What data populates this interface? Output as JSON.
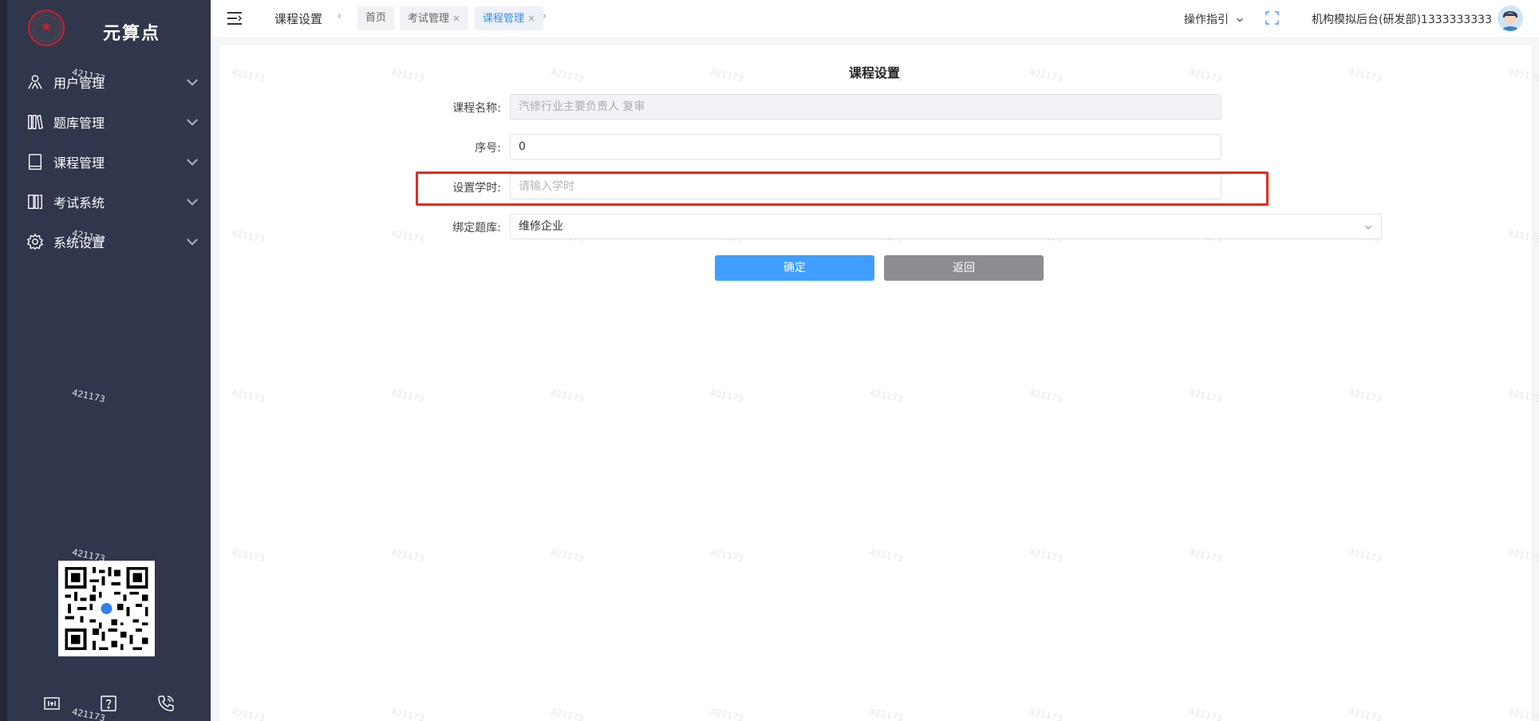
{
  "brand": {
    "name": "元算点",
    "logo_icon": "seal-logo-icon"
  },
  "sidebar": {
    "items": [
      {
        "label": "用户管理",
        "icon": "users-icon"
      },
      {
        "label": "题库管理",
        "icon": "books-icon"
      },
      {
        "label": "课程管理",
        "icon": "book-icon"
      },
      {
        "label": "考试系统",
        "icon": "exam-icon"
      },
      {
        "label": "系统设置",
        "icon": "gear-icon"
      }
    ],
    "bottom_icons": [
      "board-icon",
      "help-icon",
      "phone-icon"
    ]
  },
  "header": {
    "page_name": "课程设置",
    "tabs": [
      {
        "label": "首页",
        "closable": false,
        "active": false
      },
      {
        "label": "考试管理",
        "closable": true,
        "active": false
      },
      {
        "label": "课程管理",
        "closable": true,
        "active": true
      }
    ],
    "close_glyph": "×",
    "prev_glyph": "‹",
    "next_glyph": "›",
    "guide_label": "操作指引",
    "user_label": "机构模拟后台(研发部)1333333333"
  },
  "form": {
    "title": "课程设置",
    "course_name": {
      "label": "课程名称:",
      "value": "汽修行业主要负责人 复审"
    },
    "seq": {
      "label": "序号:",
      "value": "0"
    },
    "hours": {
      "label": "设置学时:",
      "placeholder": "请输入学时"
    },
    "bank": {
      "label": "绑定题库:",
      "value": "维修企业"
    },
    "confirm_label": "确定",
    "back_label": "返回"
  },
  "watermark_text": "421173",
  "colors": {
    "sidebar_bg": "#30364b",
    "primary": "#409eff",
    "highlight_red": "#e8281f",
    "back_button": "#8c8d91"
  }
}
